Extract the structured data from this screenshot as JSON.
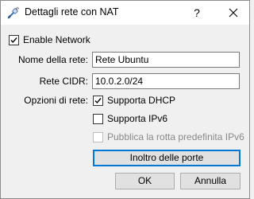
{
  "window": {
    "title": "Dettagli rete con NAT",
    "help_label": "?",
    "app_icon": "network-cable-icon",
    "close_icon": "close-icon"
  },
  "enable_network": {
    "label": "Enable Network",
    "checked": true
  },
  "fields": {
    "name_label": "Nome della rete:",
    "name_value": "Rete Ubuntu",
    "cidr_label": "Rete CIDR:",
    "cidr_value": "10.0.2.0/24",
    "options_label": "Opzioni di rete:"
  },
  "options": {
    "dhcp": {
      "label": "Supporta DHCP",
      "checked": true
    },
    "ipv6": {
      "label": "Supporta IPv6",
      "checked": false
    },
    "ipv6_route": {
      "label": "Pubblica la rotta predefinita IPv6",
      "checked": false,
      "disabled": true
    }
  },
  "buttons": {
    "port_forwarding": "Inoltro delle porte",
    "ok": "OK",
    "cancel": "Annulla"
  },
  "colors": {
    "accent": "#0078d7",
    "window_bg": "#f0f0f0",
    "titlebar_bg": "#ffffff"
  }
}
